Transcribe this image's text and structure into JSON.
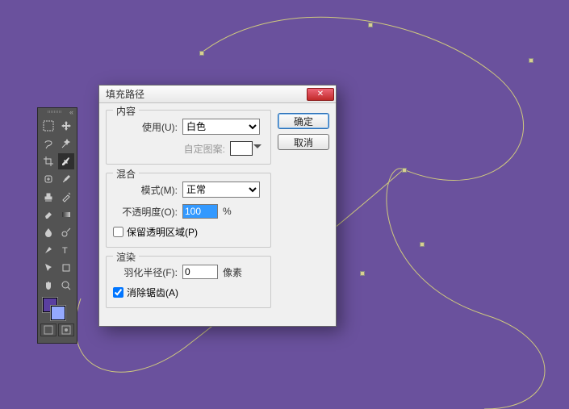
{
  "canvas": {
    "bg": "#6a519d"
  },
  "toolbox": {
    "tools": [
      "marquee",
      "move",
      "lasso",
      "wand",
      "crop",
      "slice",
      "eyedropper",
      "healing",
      "brush",
      "stamp",
      "history",
      "eraser",
      "gradient",
      "blur",
      "dodge",
      "pen",
      "type",
      "path-select",
      "rectangle",
      "hand",
      "zoom"
    ]
  },
  "dialog": {
    "title": "填充路径",
    "ok": "确定",
    "cancel": "取消",
    "groups": {
      "content": {
        "legend": "内容",
        "use_label": "使用(U):",
        "use_value": "白色",
        "custom_pattern_label": "自定图案:"
      },
      "blend": {
        "legend": "混合",
        "mode_label": "模式(M):",
        "mode_value": "正常",
        "opacity_label": "不透明度(O):",
        "opacity_value": "100",
        "opacity_unit": "%",
        "preserve_label": "保留透明区域(P)",
        "preserve_checked": false
      },
      "render": {
        "legend": "渲染",
        "feather_label": "羽化半径(F):",
        "feather_value": "0",
        "feather_unit": "像素",
        "antialias_label": "消除锯齿(A)",
        "antialias_checked": true
      }
    }
  }
}
